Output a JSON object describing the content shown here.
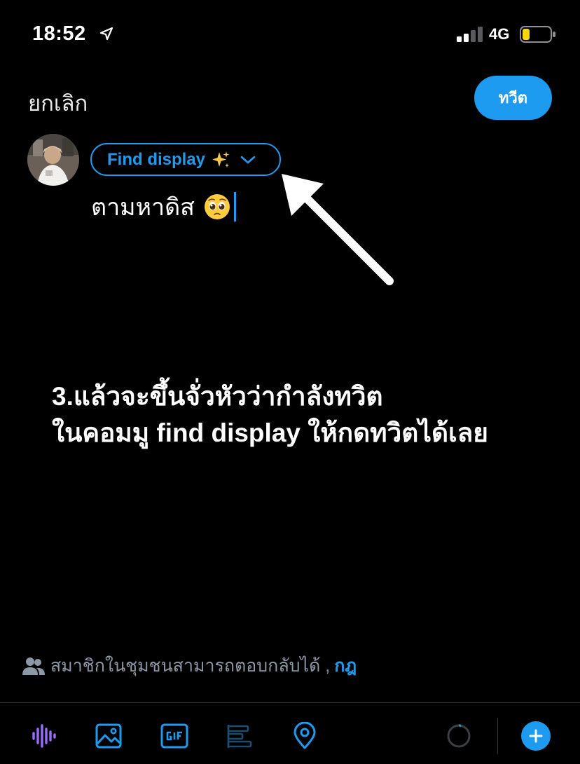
{
  "status_bar": {
    "time": "18:52",
    "network": "4G",
    "signal_bars_active": 2,
    "signal_bars_total": 4,
    "battery_level": 0.2
  },
  "header": {
    "cancel_label": "ยกเลิก",
    "tweet_button_label": "ทวีต"
  },
  "composer": {
    "audience_label": "Find display",
    "text": "ตามหาดิส",
    "emoji": "pleading-face"
  },
  "annotation": {
    "caption_line1": "3.แล้วจะขึ้นจั่วหัวว่ากำลังทวิต",
    "caption_line2": "ในคอมมู find display ให้กดทวิตได้เลย"
  },
  "reply_settings": {
    "text": "สมาชิกในชุมชนสามารถตอบกลับได้ ,",
    "rules_link": "กฎ"
  },
  "toolbar": {
    "icons": [
      "voice-waveform-icon",
      "image-icon",
      "gif-icon",
      "poll-icon",
      "location-icon",
      "character-count-ring",
      "add-thread-icon"
    ]
  },
  "colors": {
    "accent": "#1d9bf0",
    "voice": "#9b6cf7",
    "background": "#000000",
    "muted": "#8b98a5"
  }
}
